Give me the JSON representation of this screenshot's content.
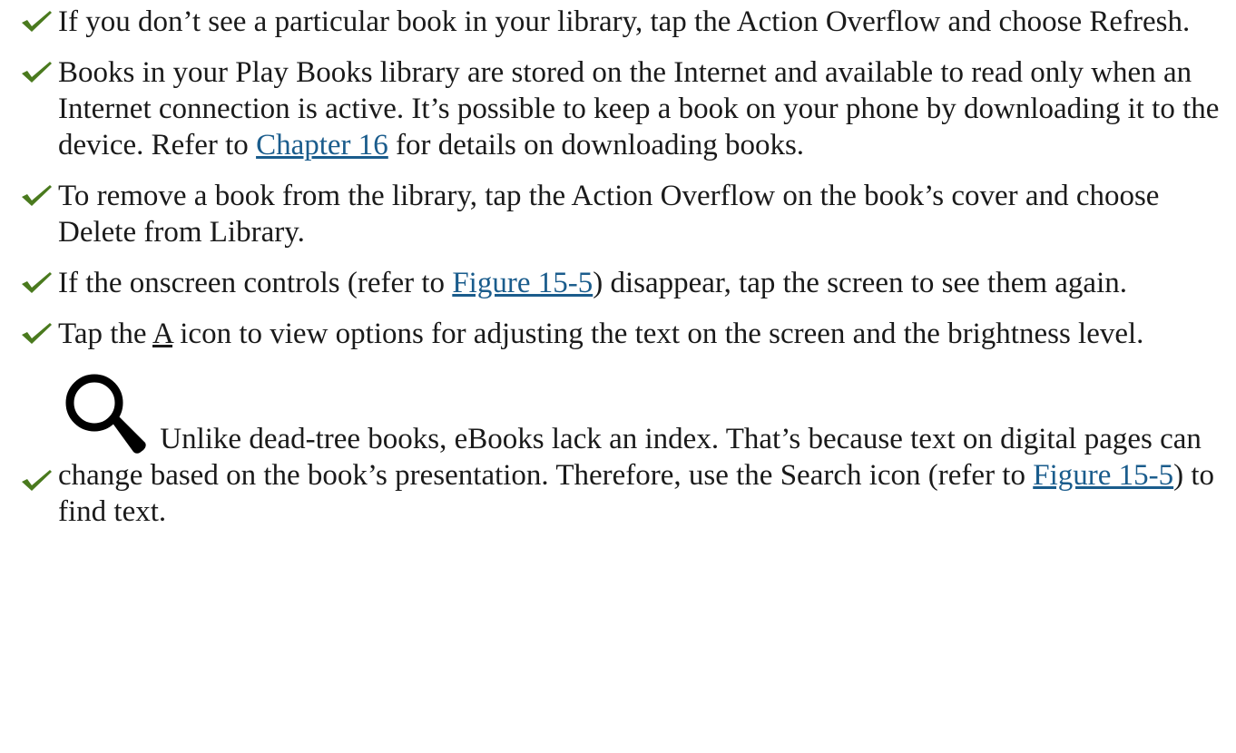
{
  "items": [
    {
      "text": "If you don’t see a particular book in your library, tap the Action Overflow and choose Refresh."
    },
    {
      "before": "Books in your Play Books library are stored on the Internet and available to read only when an Internet connection is active. It’s possible to keep a book on your phone by downloading it to the device. Refer to ",
      "link": "Chapter 16",
      "after": " for details on downloading books."
    },
    {
      "text": "To remove a book from the library, tap the Action Overflow on the book’s cover and choose Delete from Library."
    },
    {
      "before": "If the onscreen controls (refer to ",
      "link": "Figure 15-5",
      "after": ") disappear, tap the screen to see them again."
    },
    {
      "before": "Tap the ",
      "a_icon": "A",
      "after": " icon to view options for adjusting the text on the screen and the brightness level."
    },
    {
      "icon": "search-icon",
      "before": " Unlike dead-tree books, eBooks lack an index. That’s because text on digital pages can change based on the book’s presentation. Therefore, use the Search icon (refer to ",
      "link": "Figure 15-5",
      "after": ") to find text."
    }
  ],
  "colors": {
    "text": "#1a1a1a",
    "link": "#1a5c8c",
    "check": "#4a7a1e"
  }
}
